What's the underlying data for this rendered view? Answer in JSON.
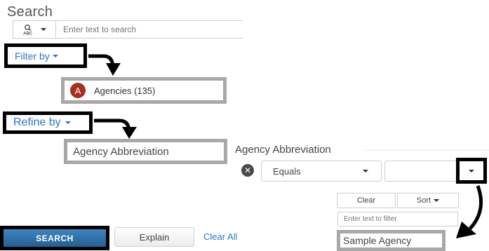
{
  "search": {
    "title": "Search",
    "type_icon": "abc-search-icon",
    "placeholder": "Enter text to search"
  },
  "filter": {
    "label": "Filter by",
    "selected": {
      "avatar_letter": "A",
      "label": "Agencies (135)"
    }
  },
  "refine": {
    "label": "Refine by",
    "selected": "Agency Abbreviation"
  },
  "panel": {
    "title": "Agency Abbreviation",
    "operator": "Equals",
    "value": "",
    "clear_label": "Clear",
    "sort_label": "Sort",
    "filter_placeholder": "Enter text to filter",
    "option": "Sample Agency"
  },
  "actions": {
    "search_label": "SEARCH",
    "explain_label": "Explain",
    "clear_all_label": "Clear All"
  },
  "colors": {
    "link_blue": "#2c77c7",
    "avatar_red": "#a6301c",
    "search_button": "#2d6fa6",
    "highlight_black": "#000000",
    "highlight_gray": "#a8a8a8"
  }
}
